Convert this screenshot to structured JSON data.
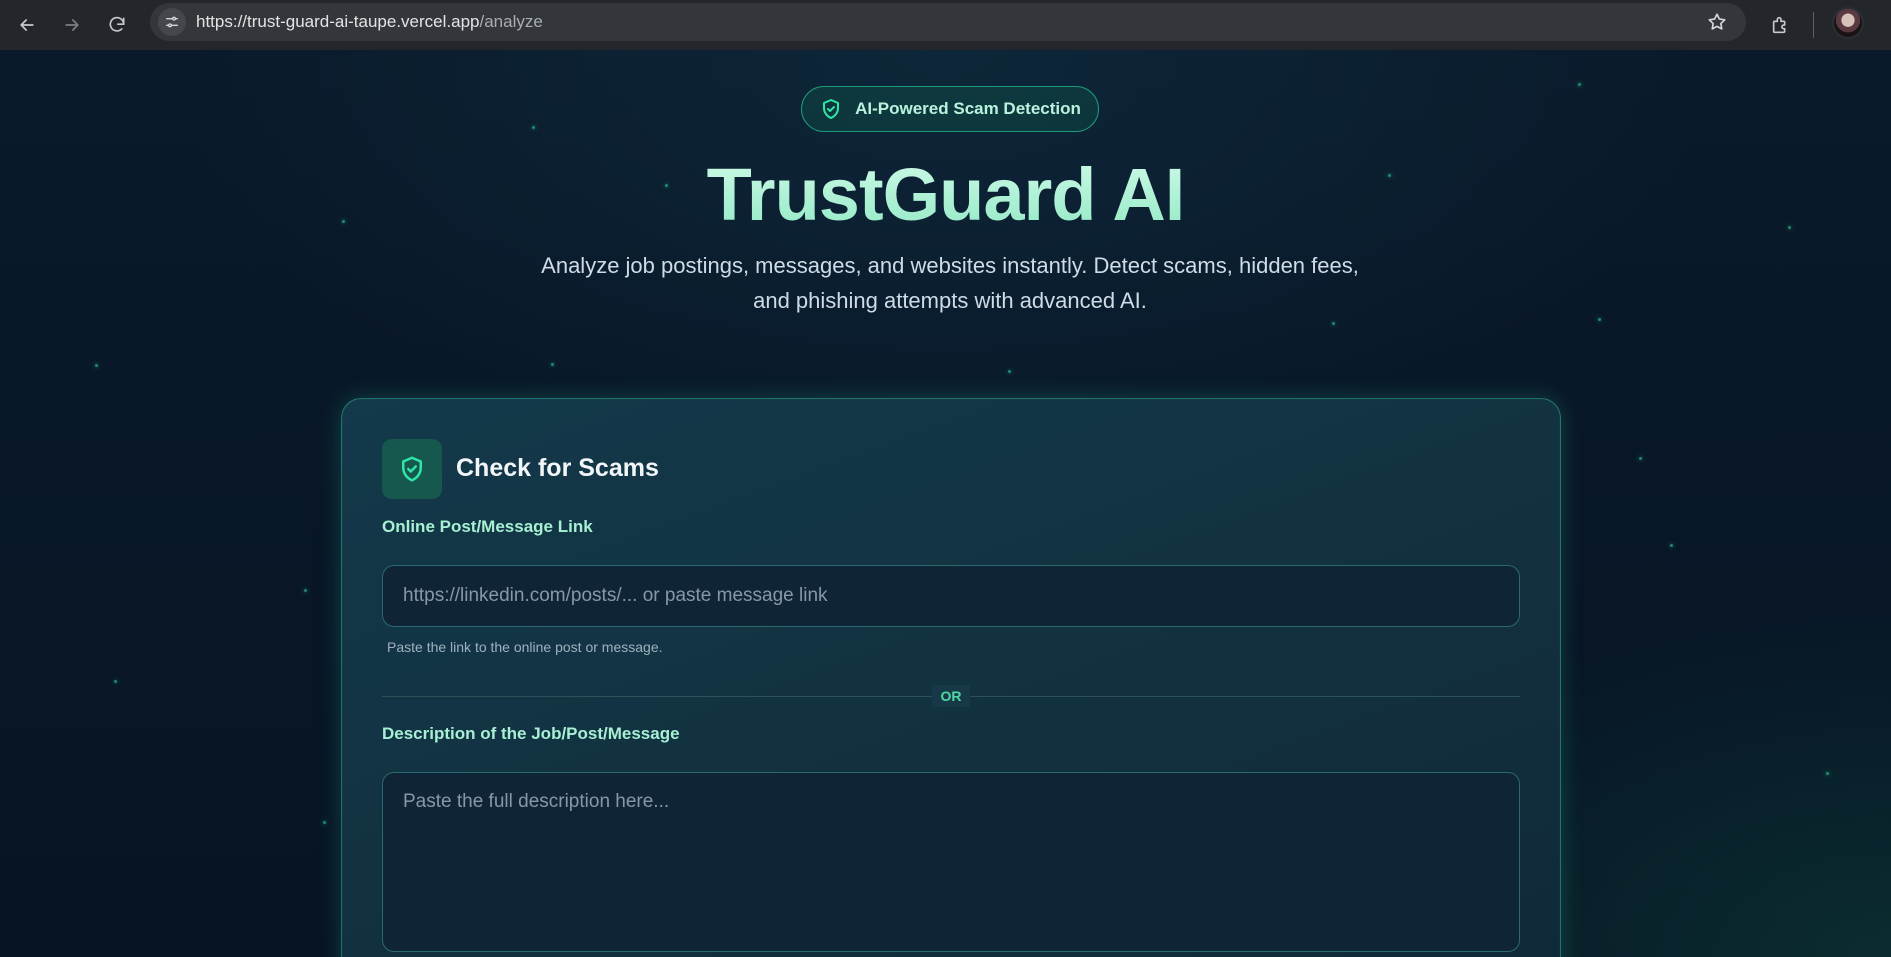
{
  "browser": {
    "url_host": "https://trust-guard-ai-taupe.vercel.app",
    "url_path": "/analyze"
  },
  "hero": {
    "badge": "AI-Powered Scam Detection",
    "title": "TrustGuard AI",
    "subtitle": "Analyze job postings, messages, and websites instantly. Detect scams, hidden fees, and phishing attempts with advanced AI."
  },
  "card": {
    "title": "Check for Scams",
    "link_label": "Online Post/Message Link",
    "link_placeholder": "https://linkedin.com/posts/... or paste message link",
    "link_value": "",
    "link_help": "Paste the link to the online post or message.",
    "divider_text": "OR",
    "description_label": "Description of the Job/Post/Message",
    "description_placeholder": "Paste the full description here...",
    "description_value": ""
  },
  "colors": {
    "accent": "#2ee6a8",
    "title_gradient_start": "#d2fbe9",
    "title_gradient_end": "#8fe8c4",
    "page_background": "#071524",
    "card_border": "#2ec8a0"
  },
  "icons": {
    "back": "arrow-left-icon",
    "forward": "arrow-right-icon",
    "reload": "reload-icon",
    "site_info": "tune-icon",
    "bookmark": "star-icon",
    "extensions": "puzzle-icon",
    "badge": "shield-check-icon",
    "card": "shield-check-icon"
  }
}
